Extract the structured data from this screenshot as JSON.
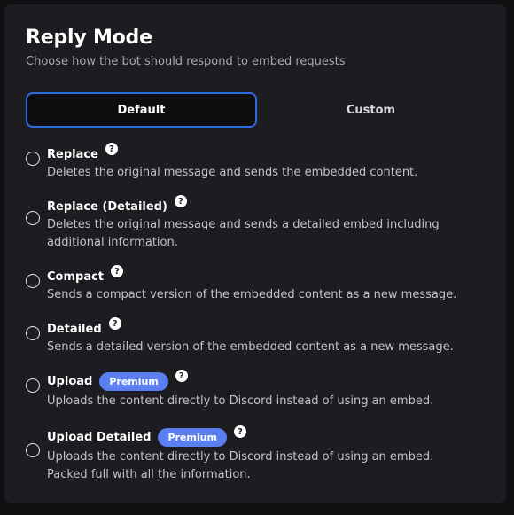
{
  "header": {
    "title": "Reply Mode",
    "subtitle": "Choose how the bot should respond to embed requests"
  },
  "tabs": [
    {
      "label": "Default",
      "active": true
    },
    {
      "label": "Custom",
      "active": false
    }
  ],
  "options": [
    {
      "label": "Replace",
      "description": "Deletes the original message and sends the embedded content.",
      "selected": false
    },
    {
      "label": "Replace (Detailed)",
      "description": "Deletes the original message and sends a detailed embed including additional information.",
      "selected": false
    },
    {
      "label": "Compact",
      "description": "Sends a compact version of the embedded content as a new message.",
      "selected": false
    },
    {
      "label": "Detailed",
      "description": "Sends a detailed version of the embedded content as a new message.",
      "selected": false
    },
    {
      "label": "Upload",
      "badge": "Premium",
      "description": "Uploads the content directly to Discord instead of using an embed.",
      "selected": false
    },
    {
      "label": "Upload Detailed",
      "badge": "Premium",
      "description": "Uploads the content directly to Discord instead of using an embed. Packed full with all the information.",
      "selected": false
    }
  ],
  "help_glyph": "?",
  "colors": {
    "background": "#101013",
    "panel": "#1c1c21",
    "accent_border": "#2d6cdf",
    "premium_badge": "#5b7ef0"
  }
}
